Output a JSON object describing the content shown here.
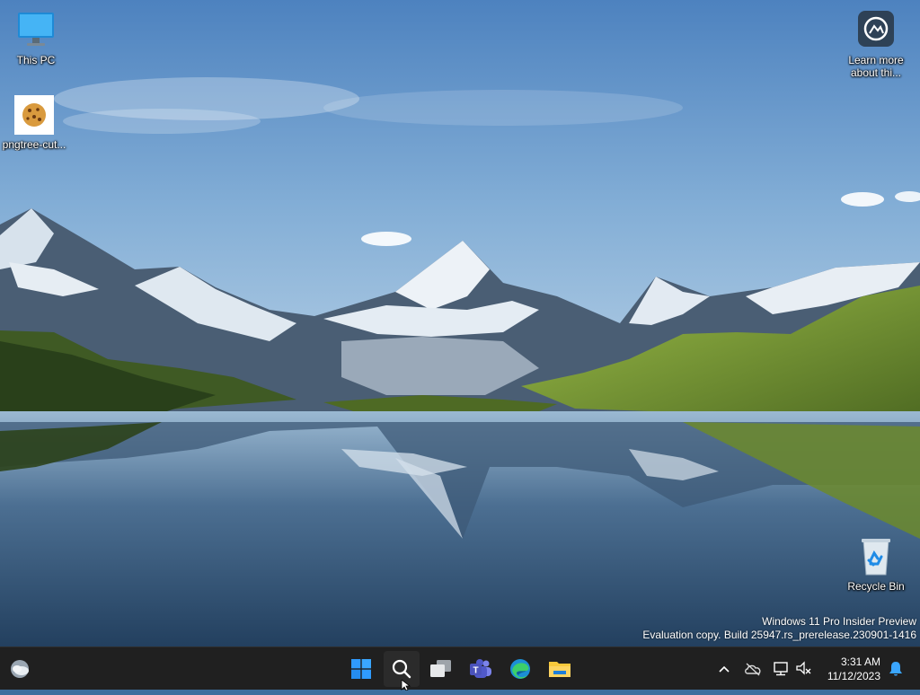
{
  "desktop": {
    "icons": [
      {
        "label": "This PC"
      },
      {
        "label": "pngtree-cut..."
      },
      {
        "label": "Learn more about thi..."
      },
      {
        "label": "Recycle Bin"
      }
    ]
  },
  "watermark": {
    "line1": "Windows 11 Pro Insider Preview",
    "line2": "Evaluation copy. Build 25947.rs_prerelease.230901-1416"
  },
  "taskbar": {
    "pinned": [
      "widgets-icon",
      "start-icon",
      "search-icon",
      "task-view-icon",
      "teams-icon",
      "edge-icon",
      "file-explorer-icon"
    ],
    "clock": {
      "time": "3:31 AM",
      "date": "11/12/2023"
    },
    "tray": [
      "chevron-up-icon",
      "onedrive-icon",
      "network-icon",
      "volume-muted-icon",
      "notifications-icon"
    ]
  },
  "colors": {
    "taskbar_bg": "#202020",
    "start_blue": "#2f9bff",
    "explorer_yellow": "#f8c83b"
  }
}
